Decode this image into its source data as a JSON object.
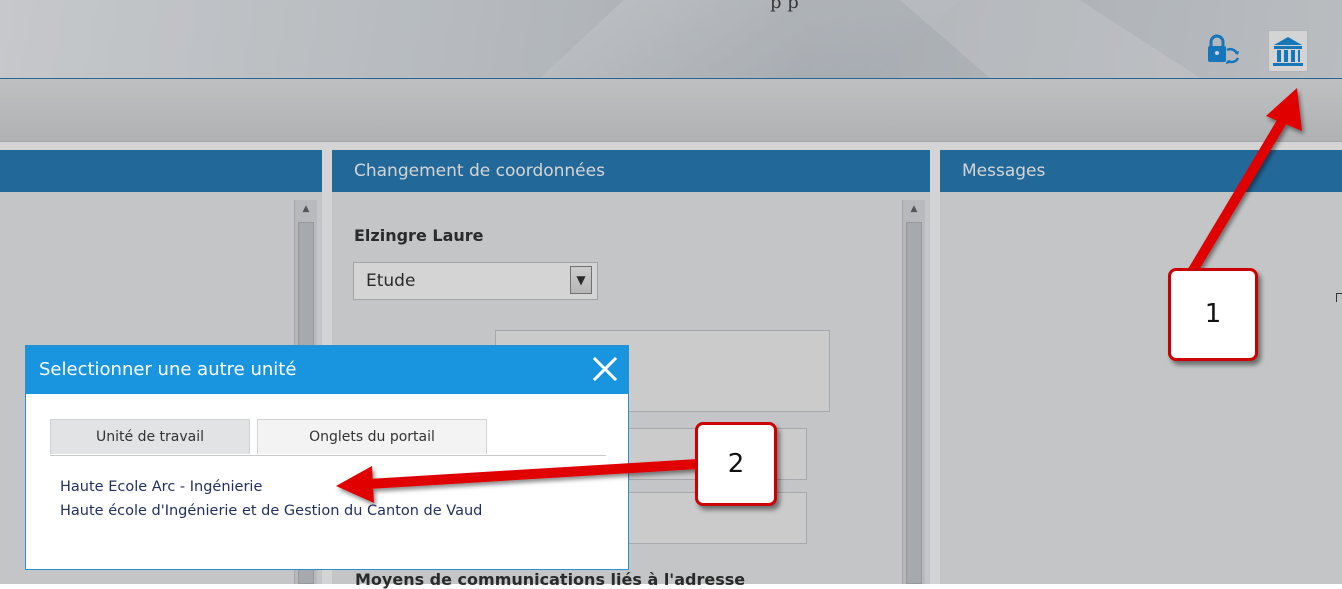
{
  "header": {
    "top_fragment": "p p",
    "icons": [
      "lock-exchange-icon",
      "building-icon"
    ]
  },
  "panels": {
    "left": {
      "title": ""
    },
    "middle": {
      "title": "Changement de coordonnées",
      "person_name": "Elzingre Laure",
      "address_type": "Etude",
      "section_heading": "Moyens de communications liés à l'adresse"
    },
    "right": {
      "title": "Messages"
    }
  },
  "dialog": {
    "title": "Selectionner une autre unité",
    "close_icon": "close-icon",
    "tabs": [
      {
        "label": "Unité de travail",
        "active": true
      },
      {
        "label": "Onglets du portail",
        "active": false
      }
    ],
    "units": [
      "Haute Ecole Arc - Ingénierie",
      "Haute école d'Ingénierie et de Gestion du Canton de Vaud"
    ]
  },
  "callouts": [
    "1",
    "2"
  ],
  "colors": {
    "panel_header": "#2a7fb8",
    "dialog_header": "#1995e0",
    "callout_red": "#e00000",
    "icon_blue": "#1a8fe0"
  }
}
